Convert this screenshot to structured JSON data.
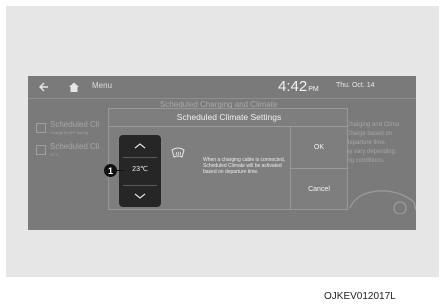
{
  "status_bar": {
    "menu_label": "Menu",
    "clock_time": "4:42",
    "clock_ampm": "PM",
    "date": "Thu. Oct. 14"
  },
  "background": {
    "header": "Scheduled Charging and Climate",
    "items": [
      {
        "title": "Scheduled Cli",
        "subtitle": "Charge EV/FP during"
      },
      {
        "title": "Scheduled Cli",
        "subtitle": "21°C"
      }
    ],
    "right_text": [
      "Charging and Clima",
      "Charge based on",
      "departure time.",
      "ay vary depending",
      "ing conditions."
    ]
  },
  "dialog": {
    "title": "Scheduled Climate Settings",
    "temperature": "23℃",
    "message": "When a charging cable is connected, Scheduled Climate will be activated based on departure time.",
    "ok_label": "OK",
    "cancel_label": "Cancel"
  },
  "callout": {
    "number": "1"
  },
  "figure_code": "OJKEV012017L",
  "colors": {
    "screen_bg": "#7a7a7a",
    "dialog_bg": "#7e7e7e",
    "temp_control_bg": "#262626",
    "text": "#f2f2f2"
  },
  "icons": [
    "back-arrow-icon",
    "home-icon",
    "defrost-icon",
    "chevron-up-icon",
    "chevron-down-icon"
  ]
}
